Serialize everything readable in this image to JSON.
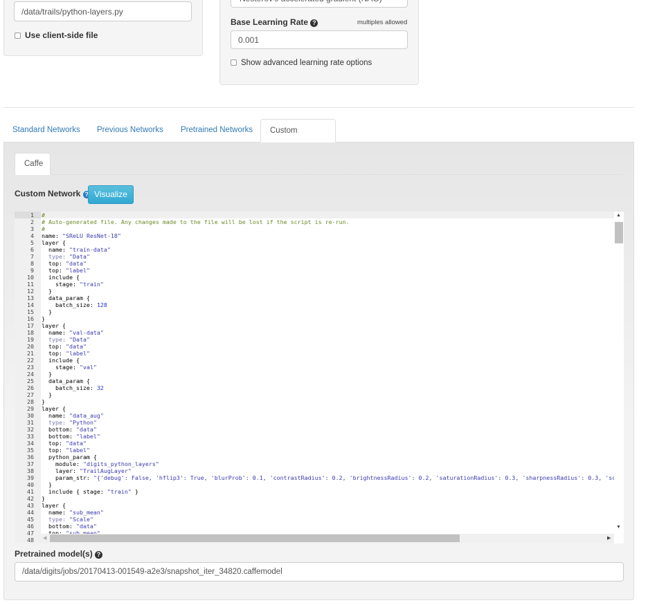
{
  "left_panel": {
    "python_layers_path": "/data/trails/python-layers.py",
    "use_client_side_label": "Use client-side file"
  },
  "right_panel": {
    "solver_selected": "Nesterov's accelerated gradient (NAG)",
    "lr_label": "Base Learning Rate",
    "lr_hint": "multiples allowed",
    "lr_value": "0.001",
    "advanced_label": "Show advanced learning rate options"
  },
  "tabs": [
    {
      "label": "Standard Networks"
    },
    {
      "label": "Previous Networks"
    },
    {
      "label": "Pretrained Networks"
    },
    {
      "label": "Custom Network",
      "active": true
    }
  ],
  "framework_tabs": [
    {
      "label": "Caffe",
      "active": true
    }
  ],
  "custom_network": {
    "label": "Custom Network",
    "visualize_label": "Visualize"
  },
  "code_lines": [
    "#",
    "# Auto-generated file. Any changes made to the file will be lost if the script is re-run.",
    "#",
    "name: \"SReLU ResNet-18\"",
    "layer {",
    "  name: \"train-data\"",
    "  type: \"Data\"",
    "  top: \"data\"",
    "  top: \"label\"",
    "  include {",
    "    stage: \"train\"",
    "  }",
    "  data_param {",
    "    batch_size: 128",
    "  }",
    "}",
    "layer {",
    "  name: \"val-data\"",
    "  type: \"Data\"",
    "  top: \"data\"",
    "  top: \"label\"",
    "  include {",
    "    stage: \"val\"",
    "  }",
    "  data_param {",
    "    batch_size: 32",
    "  }",
    "}",
    "layer {",
    "  name: \"data_aug\"",
    "  type: \"Python\"",
    "  bottom: \"data\"",
    "  bottom: \"label\"",
    "  top: \"data\"",
    "  top: \"label\"",
    "  python_param {",
    "    module: \"digits_python_layers\"",
    "    layer: \"TrailAugLayer\"",
    "    param_str: \"{'debug': False, 'hflip3': True, 'blurProb': 0.1, 'contrastRadius': 0.2, 'brightnessRadius': 0.2, 'saturationRadius': 0.3, 'sharpnessRadius': 0.3, 'scaleMin",
    "  }",
    "  include { stage: \"train\" }",
    "}",
    "layer {",
    "  name: \"sub_mean\"",
    "  type: \"Scale\"",
    "  bottom: \"data\"",
    "  top: \"sub_mean\"",
    ""
  ],
  "pretrained": {
    "label": "Pretrained model(s)",
    "value": "/data/digits/jobs/20170413-001549-a2e3/snapshot_iter_34820.caffemodel"
  }
}
